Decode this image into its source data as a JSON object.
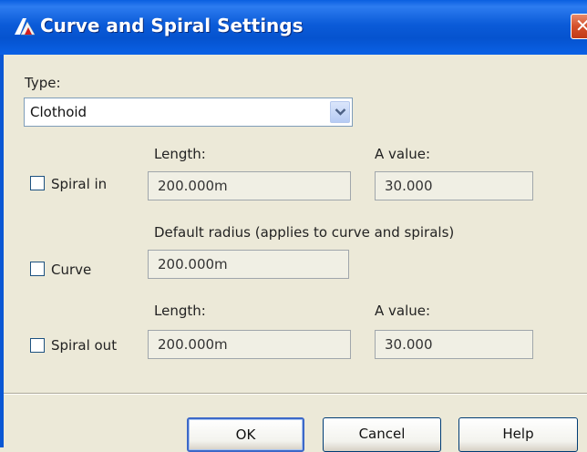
{
  "window": {
    "title": "Curve and Spiral Settings",
    "close_glyph": "✕"
  },
  "type_section": {
    "label": "Type:",
    "selected": "Clothoid"
  },
  "spiral_in": {
    "checkbox_label": "Spiral in",
    "checked": false,
    "length_label": "Length:",
    "length_value": "200.000m",
    "a_label": "A value:",
    "a_value": "30.000"
  },
  "curve": {
    "checkbox_label": "Curve",
    "checked": false,
    "radius_label": "Default radius (applies to curve and spirals)",
    "radius_value": "200.000m"
  },
  "spiral_out": {
    "checkbox_label": "Spiral out",
    "checked": false,
    "length_label": "Length:",
    "length_value": "200.000m",
    "a_label": "A value:",
    "a_value": "30.000"
  },
  "buttons": {
    "ok": "OK",
    "cancel": "Cancel",
    "help": "Help"
  },
  "colors": {
    "titlebar": "#0553cf",
    "dialog_bg": "#ECE9D8",
    "close_button": "#d4502b"
  },
  "icons": {
    "app": "autocad-app-icon",
    "dropdown": "chevron-down-icon",
    "close": "close-icon"
  }
}
